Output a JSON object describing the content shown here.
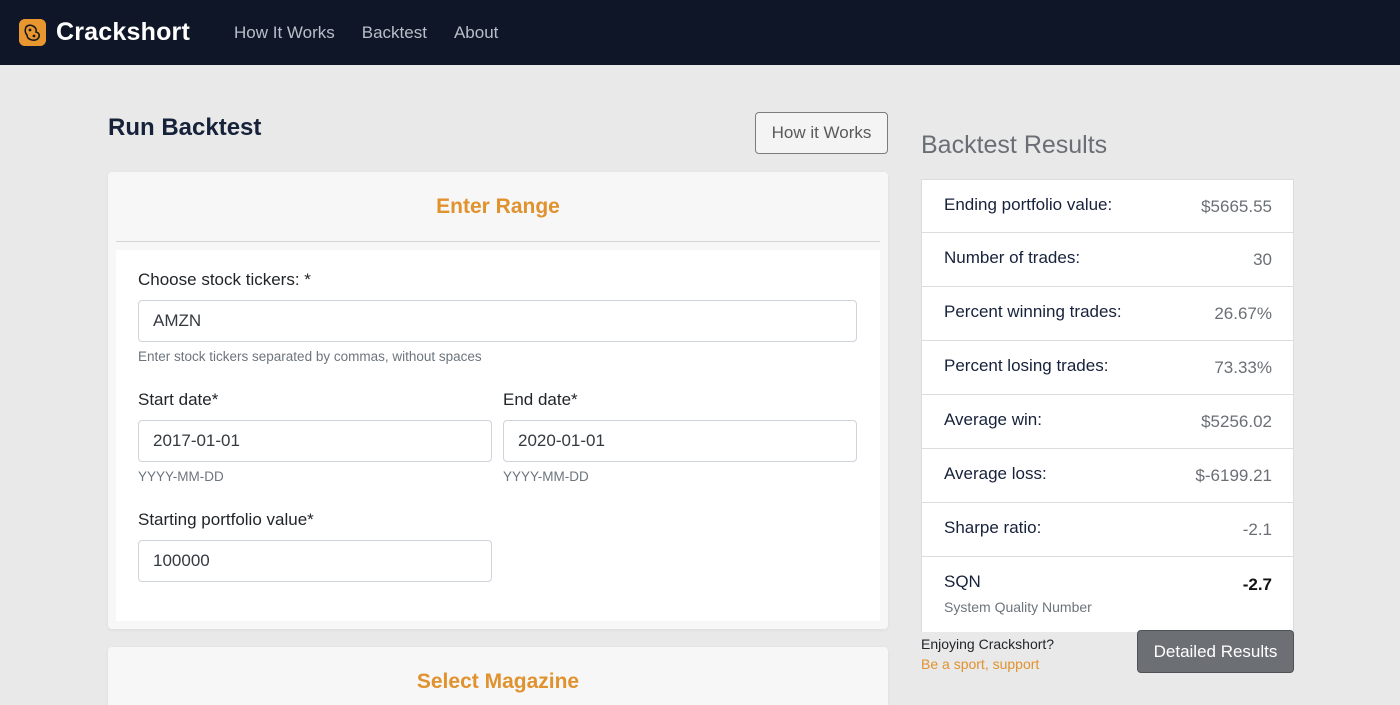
{
  "navbar": {
    "brand": "Crackshort",
    "links": [
      "How It Works",
      "Backtest",
      "About"
    ]
  },
  "main": {
    "title": "Run Backtest",
    "how_button": "How it Works",
    "range_card": {
      "header": "Enter Range",
      "tickers_label": "Choose stock tickers: *",
      "tickers_value": "AMZN",
      "tickers_help": "Enter stock tickers separated by commas, without spaces",
      "start_label": "Start date*",
      "start_value": "2017-01-01",
      "start_help": "YYYY-MM-DD",
      "end_label": "End date*",
      "end_value": "2020-01-01",
      "end_help": "YYYY-MM-DD",
      "portfolio_label": "Starting portfolio value*",
      "portfolio_value": "100000"
    },
    "magazine_card": {
      "header": "Select Magazine"
    }
  },
  "results": {
    "title": "Backtest Results",
    "rows": [
      {
        "label": "Ending portfolio value:",
        "value": "$5665.55"
      },
      {
        "label": "Number of trades:",
        "value": "30"
      },
      {
        "label": "Percent winning trades:",
        "value": "26.67%"
      },
      {
        "label": "Percent losing trades:",
        "value": "73.33%"
      },
      {
        "label": "Average win:",
        "value": "$5256.02"
      },
      {
        "label": "Average loss:",
        "value": "$-6199.21"
      },
      {
        "label": "Sharpe ratio:",
        "value": "-2.1"
      }
    ],
    "sqn": {
      "label": "SQN",
      "value": "-2.7",
      "subtitle": "System Quality Number"
    },
    "enjoy_text": "Enjoying Crackshort?",
    "support_link": "Be a sport, support",
    "detailed_button": "Detailed Results"
  },
  "colors": {
    "navbar": "#0e1628",
    "accent": "#e0922f",
    "page_bg": "#e9e9e9"
  }
}
